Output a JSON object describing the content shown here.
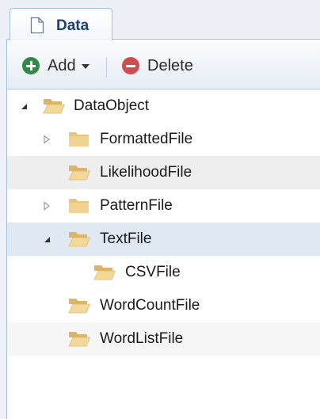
{
  "tab": {
    "label": "Data",
    "icon": "document-icon"
  },
  "toolbar": {
    "add_label": "Add",
    "delete_label": "Delete",
    "add_color": "#2f8a43",
    "delete_color": "#d04d4d"
  },
  "tree": {
    "items": [
      {
        "label": "DataObject",
        "level": 0,
        "toggle": "expanded",
        "folder": "open",
        "state": "normal"
      },
      {
        "label": "FormattedFile",
        "level": 1,
        "toggle": "collapsed",
        "folder": "closed",
        "state": "normal"
      },
      {
        "label": "LikelihoodFile",
        "level": 1,
        "toggle": "none",
        "folder": "open",
        "state": "hover"
      },
      {
        "label": "PatternFile",
        "level": 1,
        "toggle": "collapsed",
        "folder": "closed",
        "state": "normal"
      },
      {
        "label": "TextFile",
        "level": 1,
        "toggle": "expanded",
        "folder": "open",
        "state": "selected"
      },
      {
        "label": "CSVFile",
        "level": 2,
        "toggle": "none",
        "folder": "open",
        "state": "normal"
      },
      {
        "label": "WordCountFile",
        "level": 1,
        "toggle": "none",
        "folder": "open",
        "state": "normal"
      },
      {
        "label": "WordListFile",
        "level": 1,
        "toggle": "none",
        "folder": "open",
        "state": "alt"
      }
    ]
  }
}
